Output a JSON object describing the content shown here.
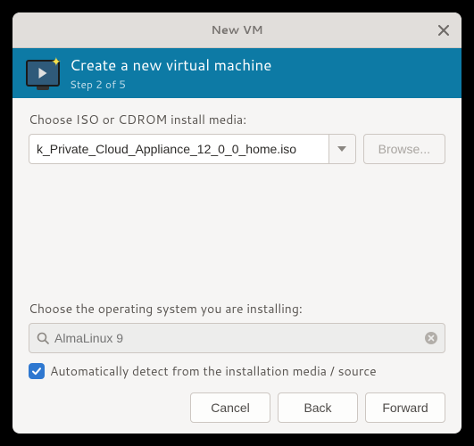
{
  "titlebar": {
    "title": "New VM"
  },
  "header": {
    "title": "Create a new virtual machine",
    "step": "Step 2 of 5"
  },
  "media": {
    "label": "Choose ISO or CDROM install media:",
    "value": "k_Private_Cloud_Appliance_12_0_0_home.iso",
    "browse": "Browse..."
  },
  "os": {
    "label": "Choose the operating system you are installing:",
    "placeholder": "AlmaLinux 9",
    "autodetect_label": "Automatically detect from the installation media / source",
    "autodetect_checked": true
  },
  "footer": {
    "cancel": "Cancel",
    "back": "Back",
    "forward": "Forward"
  }
}
